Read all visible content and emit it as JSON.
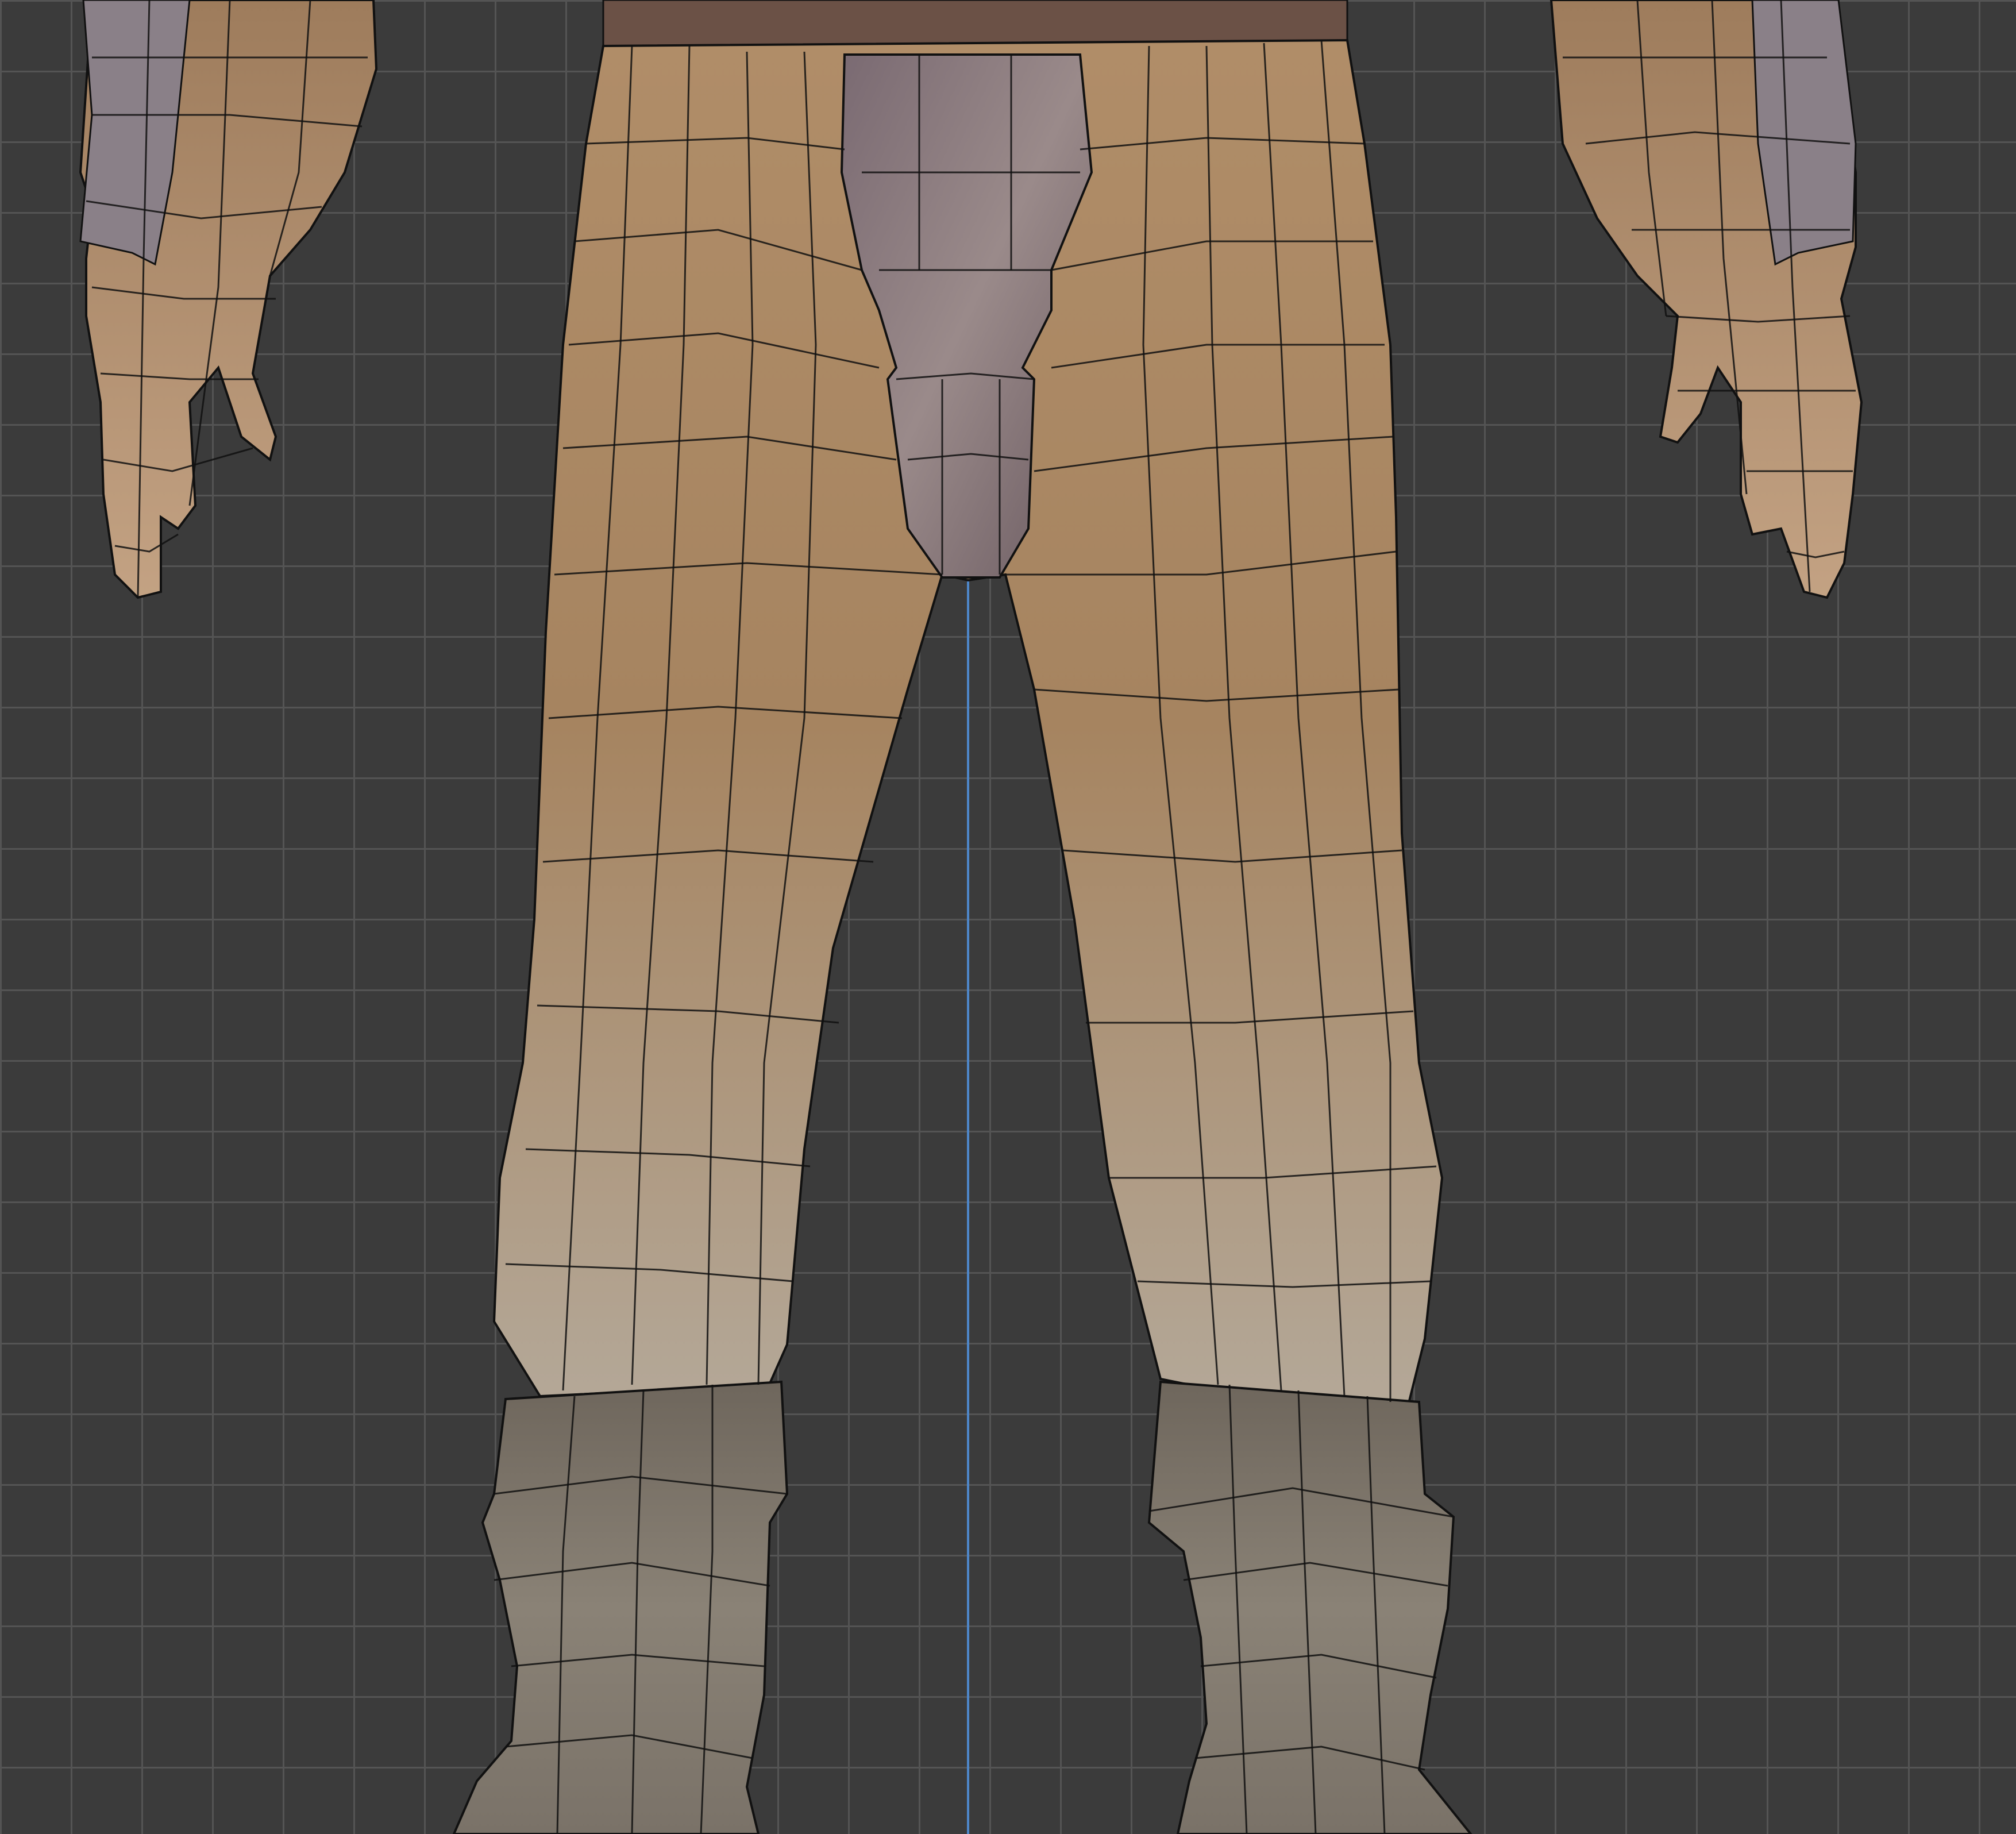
{
  "viewport": {
    "view": "front-orthographic",
    "grid": true,
    "colors": {
      "background": "#3b3b3b",
      "grid_line": "#545454",
      "axis_line": "#4e86c8",
      "wireframe": "#111111",
      "pants": "#a78560",
      "boots": "#7a7268",
      "belt": "#6b5146"
    }
  },
  "model": {
    "parts": [
      "left-hand",
      "right-hand",
      "pants",
      "crotch-flap",
      "left-boot",
      "right-boot",
      "belt"
    ]
  }
}
